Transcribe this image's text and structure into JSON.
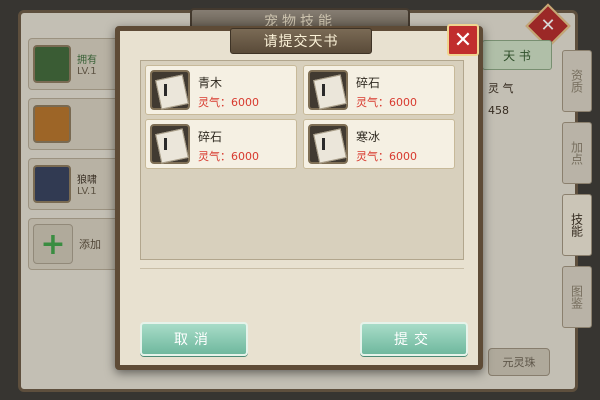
{
  "background": {
    "header_title": "宠物技能",
    "right_info": {
      "tab_label": "天 书",
      "label": "灵 气",
      "value": "458"
    },
    "side_tabs": [
      "资质",
      "加点",
      "技能",
      "图鉴"
    ],
    "bottom_button": "元灵珠",
    "left_list": {
      "pets": [
        {
          "name": "拥有",
          "level": "LV.1"
        },
        {
          "name": "",
          "level": ""
        },
        {
          "name": "狼啸",
          "level": "LV.1"
        }
      ],
      "add_label": "添加"
    }
  },
  "modal": {
    "title": "请提交天书",
    "books": [
      {
        "name": "青木",
        "value": "灵气：6000"
      },
      {
        "name": "碎石",
        "value": "灵气：6000"
      },
      {
        "name": "碎石",
        "value": "灵气：6000"
      },
      {
        "name": "寒冰",
        "value": "灵气：6000"
      }
    ],
    "cancel_label": "取消",
    "submit_label": "提交"
  }
}
